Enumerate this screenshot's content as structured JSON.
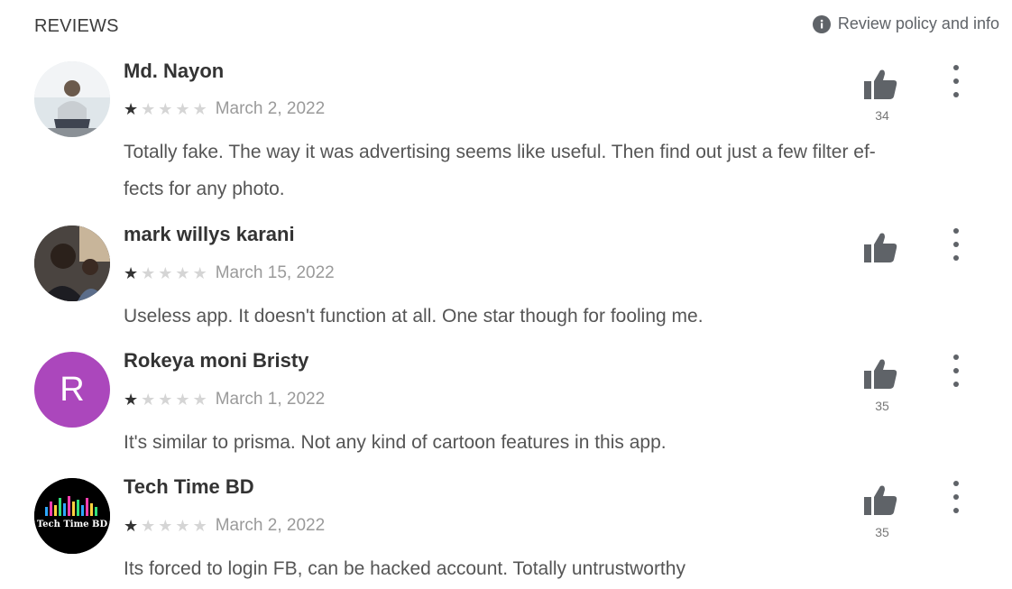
{
  "header": {
    "title": "REVIEWS",
    "policy_label": "Review policy and info",
    "policy_icon": "info-icon"
  },
  "colors": {
    "star_filled": "#333333",
    "star_empty": "#d5d5d5",
    "avatar_rokeya": "#ab47bc",
    "thumb": "#5f6368"
  },
  "reviews": [
    {
      "author": "Md. Nayon",
      "rating": 1,
      "max_rating": 5,
      "date": "March 2, 2022",
      "text_line1": "Totally fake. The way it was advertising seems like useful. Then find out just a few filter ef-",
      "text_line2": "fects for any photo.",
      "helpful_count": "34",
      "avatar": "photo"
    },
    {
      "author": "mark willys karani",
      "rating": 1,
      "max_rating": 5,
      "date": "March 15, 2022",
      "text_line1": "Useless app. It doesn't function at all. One star though for fooling me.",
      "text_line2": "",
      "helpful_count": "",
      "avatar": "photo"
    },
    {
      "author": "Rokeya moni Bristy",
      "rating": 1,
      "max_rating": 5,
      "date": "March 1, 2022",
      "text_line1": "It's similar to prisma. Not any kind of cartoon features in this app.",
      "text_line2": "",
      "helpful_count": "35",
      "avatar": "letter",
      "avatar_letter": "R"
    },
    {
      "author": "Tech Time BD",
      "rating": 1,
      "max_rating": 5,
      "date": "March 2, 2022",
      "text_line1": "Its forced to login FB, can be hacked account. Totally untrustworthy",
      "text_line2": "",
      "helpful_count": "35",
      "avatar": "logo",
      "avatar_logo_text": "Tech Time BD"
    }
  ]
}
